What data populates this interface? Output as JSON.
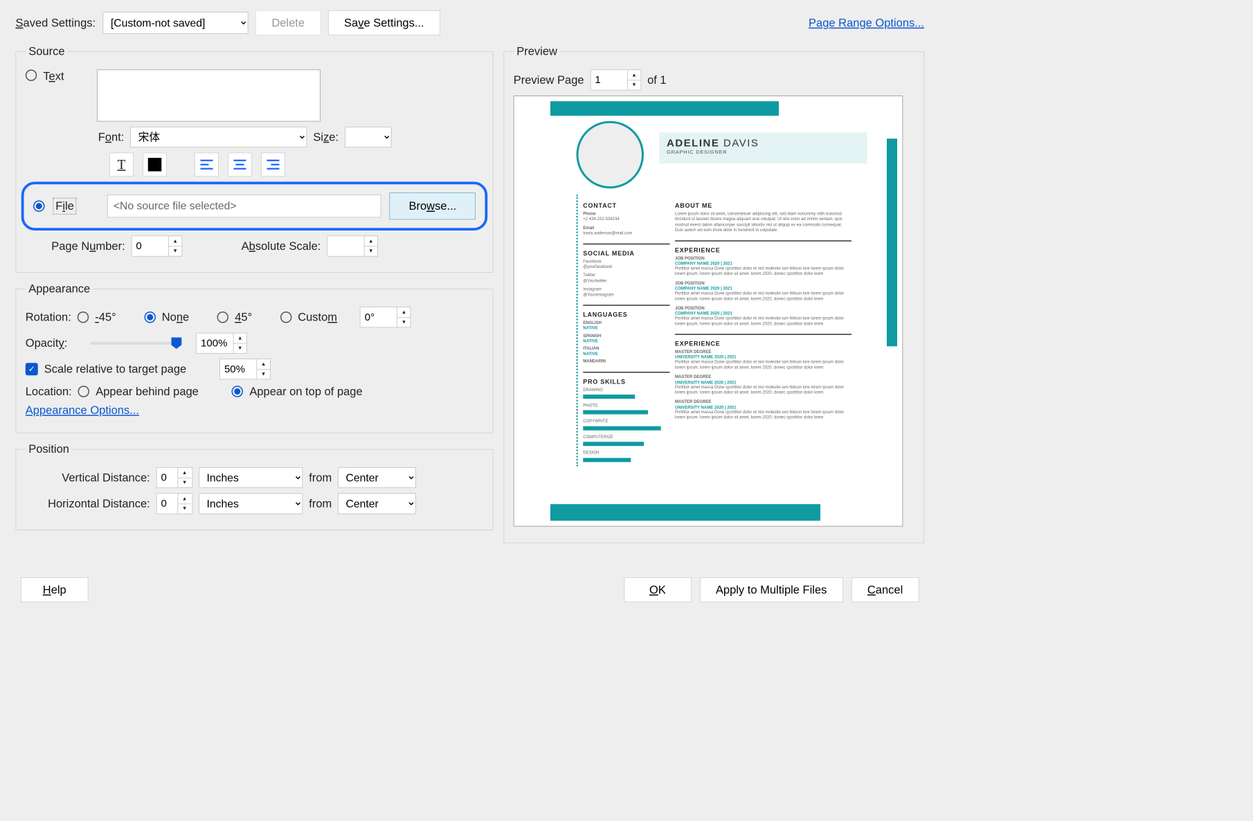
{
  "top": {
    "saved_settings_label": "Saved Settings:",
    "saved_settings_value": "[Custom-not saved]",
    "delete_label": "Delete",
    "save_settings_label": "Save Settings...",
    "page_range_link": "Page Range Options..."
  },
  "source": {
    "legend": "Source",
    "text_radio_label": "Text",
    "font_label": "Font:",
    "font_value": "宋体",
    "size_label": "Size:",
    "file_radio_label": "File",
    "file_path_placeholder": "<No source file selected>",
    "browse_label": "Browse...",
    "page_number_label": "Page Number:",
    "page_number_value": "0",
    "absolute_scale_label": "Absolute Scale:"
  },
  "appearance": {
    "legend": "Appearance",
    "rotation_label": "Rotation:",
    "rot_m45": "-45°",
    "rot_none": "None",
    "rot_45": "45°",
    "rot_custom": "Custom",
    "rot_custom_value": "0°",
    "opacity_label": "Opacity:",
    "opacity_value": "100%",
    "scale_checkbox_label": "Scale relative to target page",
    "scale_value": "50%",
    "location_label": "Location:",
    "loc_behind": "Appear behind page",
    "loc_ontop": "Appear on top of page",
    "appearance_options_link": "Appearance Options..."
  },
  "position": {
    "legend": "Position",
    "vdist_label": "Vertical Distance:",
    "vdist_value": "0",
    "hdist_label": "Horizontal Distance:",
    "hdist_value": "0",
    "unit": "Inches",
    "from_label": "from",
    "from_value": "Center"
  },
  "preview": {
    "legend": "Preview",
    "preview_page_label": "Preview Page",
    "preview_page_value": "1",
    "of_label": "of 1"
  },
  "resume": {
    "name_first": "ADELINE",
    "name_last": "DAVIS",
    "role": "GRAPHIC DESIGNER",
    "contact_h": "CONTACT",
    "phone_l": "Phone",
    "phone_v": "+2 434-232-534234",
    "email_l": "Email",
    "email_v": "travis.anderson@mail.com",
    "social_h": "SOCIAL MEDIA",
    "soc1a": "Facebook",
    "soc1b": "@yourfacebook",
    "soc2a": "Twitter",
    "soc2b": "@Yourtwitter",
    "soc3a": "Instagram",
    "soc3b": "@Yourinstagram",
    "lang_h": "LANGUAGES",
    "lang1": "ENGLISH",
    "lang2": "SPANISH",
    "lang3": "ITALIAN",
    "lang4": "MANDARIN",
    "native": "NATIVE",
    "skills_h": "PRO SKILLS",
    "sk1": "DRAWING",
    "sk2": "PHOTO",
    "sk3": "COPYWRITE",
    "sk4": "COMPUTERIZE",
    "sk5": "DESIGN",
    "about_h": "ABOUT ME",
    "about_t": "Lorem ipsum dolor sit amet, consectetuer adipiscing elit, sed diam nonummy nibh euismod tincidunt ut laoreet dolore magna aliquam erat volutpat. Ut wisi enim ad minim veniam, quis nostrud exerci tation ullamcorper suscipit lobortis nisl ut aliquip ex ea commodo consequat. Duis autem vel eum iriure dolor in hendrerit in vulputate.",
    "exp_h": "EXPERIENCE",
    "jp": "JOB POSITION",
    "comp": "COMPANY NAME 2020 | 2021",
    "exp_t": "Porttitor amet massa Done cporttitor dolor et nisl molestie ium felison lore lorem ipsum dolor lorem ipsum. lorem ipsum dolor sit amet. lorem 2020. donec cporttitor dolor krem",
    "edu_h": "EXPERIENCE",
    "md": "MASTER DEGREE",
    "uni": "UNIVERSITY NAME 2020 | 2021"
  },
  "footer": {
    "help": "Help",
    "ok": "OK",
    "apply": "Apply to Multiple Files",
    "cancel": "Cancel"
  }
}
